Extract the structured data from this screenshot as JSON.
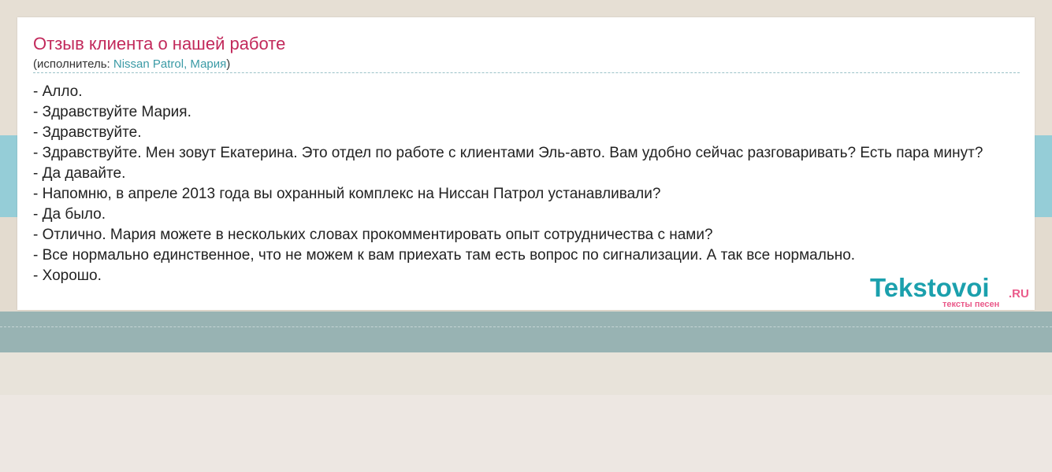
{
  "song": {
    "title": "Отзыв клиента о нашей работе",
    "performer_prefix": "(исполнитель: ",
    "performer_link": "Nissan Patrol, Мария",
    "performer_suffix": ")"
  },
  "lyrics": [
    "- Алло.",
    "- Здравствуйте Мария.",
    "- Здравствуйте.",
    "- Здравствуйте. Мен зовут Екатерина. Это отдел по работе с клиентами Эль-авто. Вам удобно сейчас разговаривать? Есть пара минут?",
    "- Да давайте.",
    "- Напомню, в апреле 2013 года вы охранный комплекс на Ниссан Патрол устанавливали?",
    "- Да было.",
    "- Отлично. Мария можете в нескольких словах прокомментировать опыт сотрудничества с нами?",
    "- Все нормально единственное, что не можем к вам приехать там есть вопрос по сигнализации. А так все нормально.",
    "- Хорошо."
  ],
  "logo": {
    "name": "Tekstovoi",
    "tld": ".RU",
    "tagline": "тексты песен"
  },
  "colors": {
    "title": "#c2295b",
    "link": "#3a9aa5",
    "logo_main": "#1ba0ad",
    "logo_accent": "#ea5a8a",
    "band_blue": "#95cdd7",
    "band_teal": "#98b3b3"
  }
}
